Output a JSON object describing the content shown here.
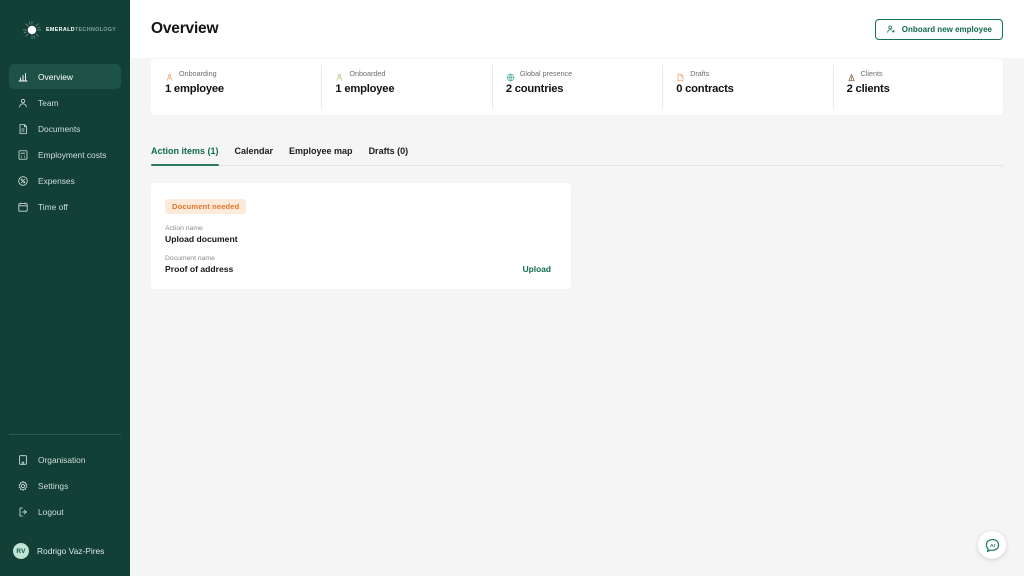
{
  "brand": {
    "name_bold": "EMERALD",
    "name_light": "TECHNOLOGY",
    "logo_icon": "emerald-gem-icon"
  },
  "sidebar": {
    "items": [
      {
        "label": "Overview",
        "icon": "bar-chart-icon",
        "active": true
      },
      {
        "label": "Team",
        "icon": "person-icon",
        "active": false
      },
      {
        "label": "Documents",
        "icon": "document-icon",
        "active": false
      },
      {
        "label": "Employment costs",
        "icon": "calculator-icon",
        "active": false
      },
      {
        "label": "Expenses",
        "icon": "percent-circle-icon",
        "active": false
      },
      {
        "label": "Time off",
        "icon": "calendar-icon",
        "active": false
      }
    ],
    "bottom_items": [
      {
        "label": "Organisation",
        "icon": "building-icon"
      },
      {
        "label": "Settings",
        "icon": "gear-icon"
      },
      {
        "label": "Logout",
        "icon": "logout-icon"
      }
    ],
    "user": {
      "initials": "RV",
      "name": "Rodrigo Vaz-Pires"
    }
  },
  "header": {
    "title": "Overview",
    "onboard_button": "Onboard new employee",
    "onboard_icon": "person-plus-icon"
  },
  "stats": [
    {
      "label": "Onboarding",
      "value": "1 employee",
      "icon": "person-icon",
      "color": "#f0a06a"
    },
    {
      "label": "Onboarded",
      "value": "1 employee",
      "icon": "person-icon",
      "color": "#b4c96a"
    },
    {
      "label": "Global presence",
      "value": "2 countries",
      "icon": "globe-icon",
      "color": "#4aa9a0"
    },
    {
      "label": "Drafts",
      "value": "0 contracts",
      "icon": "draft-doc-icon",
      "color": "#f0a06a"
    },
    {
      "label": "Clients",
      "value": "2 clients",
      "icon": "building-icon",
      "color": "#8a6a52"
    }
  ],
  "tabs": [
    {
      "label": "Action items (1)",
      "active": true
    },
    {
      "label": "Calendar",
      "active": false
    },
    {
      "label": "Employee map",
      "active": false
    },
    {
      "label": "Drafts (0)",
      "active": false
    }
  ],
  "action_card": {
    "badge": "Document needed",
    "action_name_label": "Action name",
    "action_name_value": "Upload document",
    "document_name_label": "Document name",
    "document_name_value": "Proof of address",
    "upload_link": "Upload"
  },
  "chat": {
    "icon": "ai-chat-bubble-icon",
    "text": "AI"
  },
  "colors": {
    "sidebar_bg": "#123f36",
    "accent_green": "#0f6b4b",
    "badge_bg": "#fdeadb",
    "badge_text": "#e0762b",
    "page_bg": "#f5f5f5"
  }
}
